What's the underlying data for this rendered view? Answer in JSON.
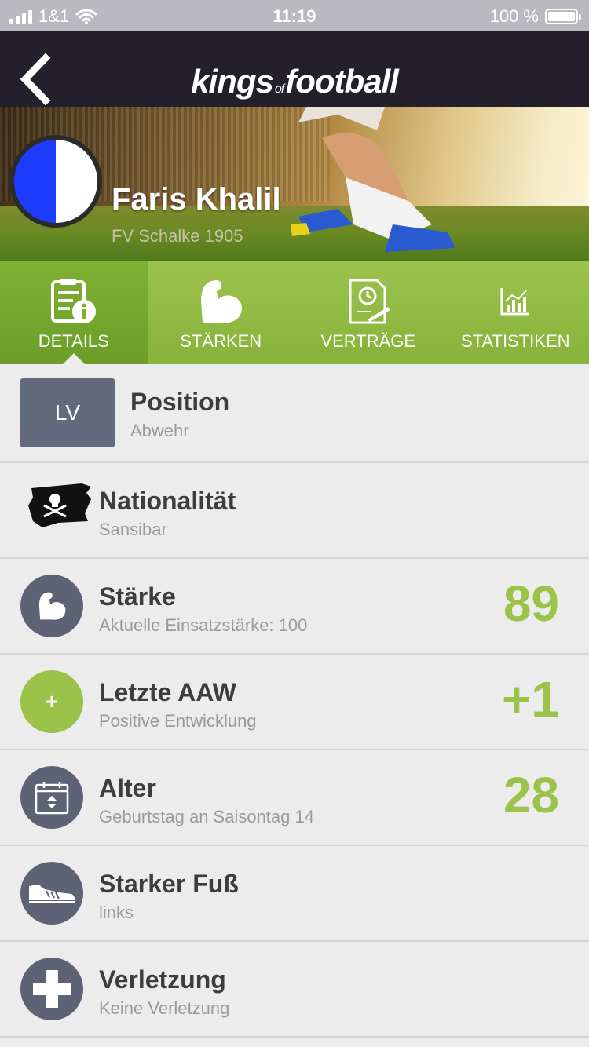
{
  "status_bar": {
    "carrier": "1&1",
    "time": "11:19",
    "battery_percent": "100 %",
    "battery_level": 1.0
  },
  "nav": {
    "logo_part1": "kings",
    "logo_part2": "of",
    "logo_part3": "football"
  },
  "player": {
    "name": "Faris Khalil",
    "club": "FV Schalke 1905",
    "club_colors": [
      "#1e3cff",
      "#ffffff"
    ]
  },
  "tabs": [
    {
      "label": "DETAILS",
      "icon": "document-info-icon",
      "active": true
    },
    {
      "label": "STÄRKEN",
      "icon": "bicep-icon",
      "active": false
    },
    {
      "label": "VERTRÄGE",
      "icon": "contract-icon",
      "active": false
    },
    {
      "label": "STATISTIKEN",
      "icon": "chart-icon",
      "active": false
    }
  ],
  "rows": [
    {
      "title": "Position",
      "subtitle": "Abwehr",
      "badge": "LV",
      "icon": "position-badge"
    },
    {
      "title": "Nationalität",
      "subtitle": "Sansibar",
      "icon": "pirate-flag-icon"
    },
    {
      "title": "Stärke",
      "subtitle": "Aktuelle Einsatzstärke: 100",
      "value": "89",
      "icon": "bicep-icon"
    },
    {
      "title": "Letzte AAW",
      "subtitle": "Positive Entwicklung",
      "value": "+1",
      "icon": "plus-icon",
      "icon_glyph": "+"
    },
    {
      "title": "Alter",
      "subtitle": "Geburtstag an Saisontag 14",
      "value": "28",
      "icon": "calendar-icon"
    },
    {
      "title": "Starker Fuß",
      "subtitle": "links",
      "icon": "shoe-icon"
    },
    {
      "title": "Verletzung",
      "subtitle": "Keine Verletzung",
      "icon": "medical-cross-icon"
    }
  ],
  "colors": {
    "accent_green": "#9bc34a",
    "nav_dark": "#231f2b",
    "icon_circle": "#5d6374"
  }
}
